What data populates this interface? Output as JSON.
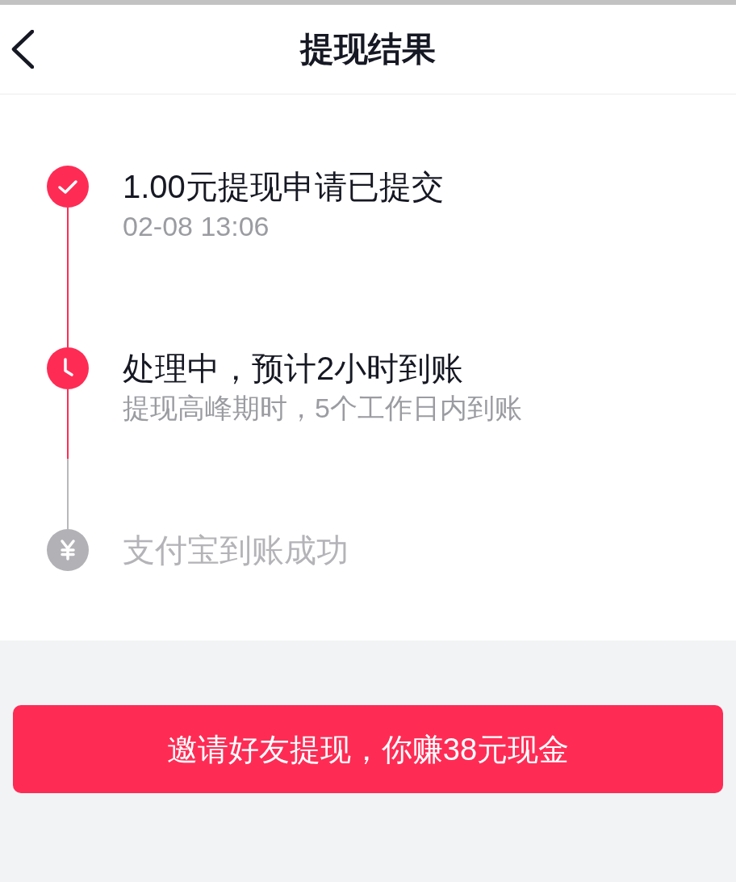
{
  "header": {
    "title": "提现结果"
  },
  "steps": [
    {
      "kind": "done",
      "title": "1.00元提现申请已提交",
      "subtitle": "02-08 13:06"
    },
    {
      "kind": "processing",
      "title": "处理中，预计2小时到账",
      "subtitle": "提现高峰期时，5个工作日内到账"
    },
    {
      "kind": "pending",
      "title": "支付宝到账成功"
    }
  ],
  "invite_button": {
    "label": "邀请好友提现，你赚38元现金"
  }
}
